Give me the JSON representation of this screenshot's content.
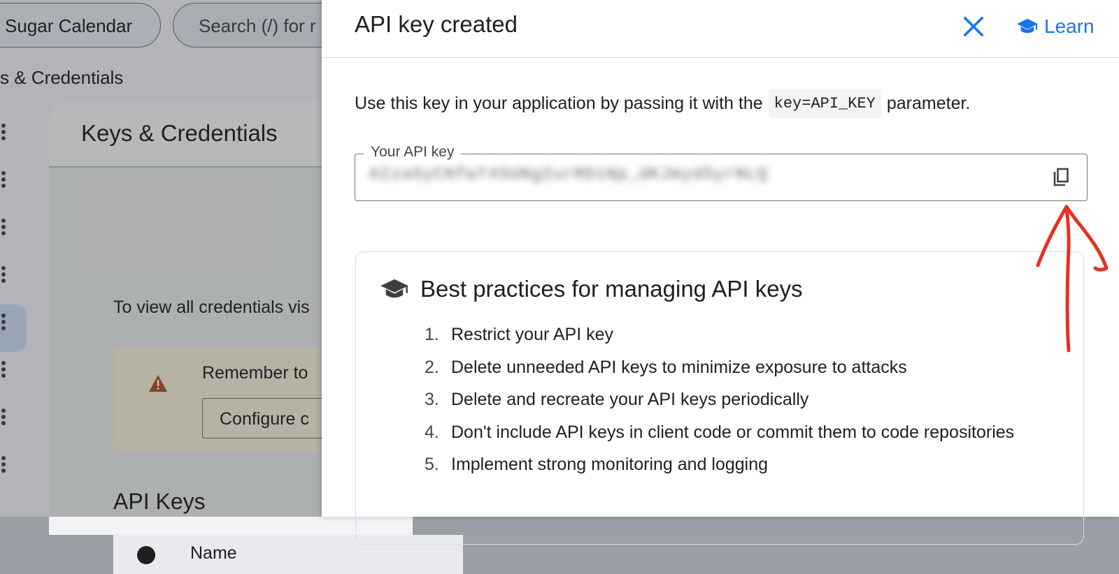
{
  "background": {
    "project_pill": "Sugar Calendar",
    "search_pill": "Search (/) for r",
    "breadcrumb": "s & Credentials",
    "card_title": "Keys & Credentials",
    "info_text": "To view all credentials vis",
    "warning_text": "Remember to",
    "warning_button": "Configure c",
    "section_title": "API Keys",
    "table_column_name": "Name"
  },
  "panel": {
    "title": "API key created",
    "learn_label": "Learn",
    "intro_before": "Use this key in your application by passing it with the",
    "intro_code": "key=API_KEY",
    "intro_after": "parameter.",
    "key_field_label": "Your API key",
    "key_field_value": "AIzaSyCNfwT4SUNgZurRDiNp_dKJmydSyrNLQ",
    "best_practices": {
      "title": "Best practices for managing API keys",
      "items": [
        {
          "num": "1.",
          "text": "Restrict your API key"
        },
        {
          "num": "2.",
          "text": "Delete unneeded API keys to minimize exposure to attacks"
        },
        {
          "num": "3.",
          "text": "Delete and recreate your API keys periodically"
        },
        {
          "num": "4.",
          "text": "Don't include API keys in client code or commit them to code repositories"
        },
        {
          "num": "5.",
          "text": "Implement strong monitoring and logging"
        }
      ]
    }
  },
  "icons": {
    "close": "close-icon",
    "learn": "school-icon",
    "copy": "copy-icon",
    "best_practices": "school-icon",
    "warning": "warning-icon"
  },
  "colors": {
    "accent": "#1a73e8",
    "annotation": "#e53222",
    "warning_bg": "#fef7e0",
    "warning_icon": "#b3541e"
  }
}
